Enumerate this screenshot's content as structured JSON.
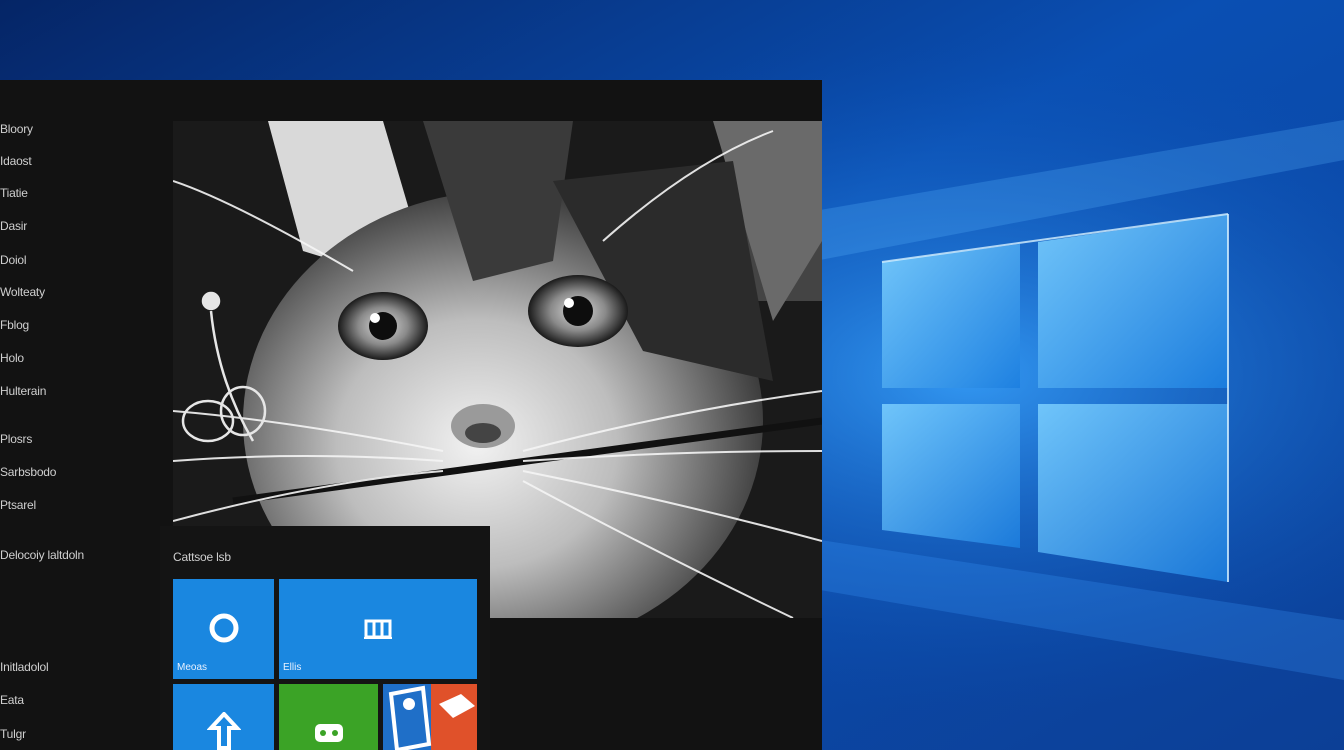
{
  "colors": {
    "desktop_blue": "#0a63c9",
    "start_bg": "#121212",
    "tile_blue": "#1a87e0",
    "tile_green": "#3ba326",
    "tile_orange": "#e0512a"
  },
  "start_menu": {
    "items": [
      {
        "label": "Bloory"
      },
      {
        "label": "Idaost"
      },
      {
        "label": "Tiatie"
      },
      {
        "label": "Dasir"
      },
      {
        "label": "Doiol"
      },
      {
        "label": "Wolteaty"
      },
      {
        "label": "Fblog"
      },
      {
        "label": "Holo"
      },
      {
        "label": "Hulterain"
      },
      {
        "label": "Plosrs"
      },
      {
        "label": "Sarbsbodo"
      },
      {
        "label": "Ptsarel"
      },
      {
        "label": "Delocoiy laltdoln"
      },
      {
        "label": "Initladolol"
      },
      {
        "label": "Eata"
      },
      {
        "label": "Tulgr"
      }
    ]
  },
  "tiles": {
    "header": "Cattsoe lsb",
    "items": [
      {
        "label": "Meoas",
        "icon": "ring-icon"
      },
      {
        "label": "Ellis",
        "icon": "store-icon"
      },
      {
        "label": "",
        "icon": "upload-arrow-icon"
      },
      {
        "label": "",
        "icon": "game-controller-icon"
      },
      {
        "label": "",
        "icon": "photo-app-icon"
      }
    ]
  },
  "photo": {
    "subject": "cat-photo"
  }
}
